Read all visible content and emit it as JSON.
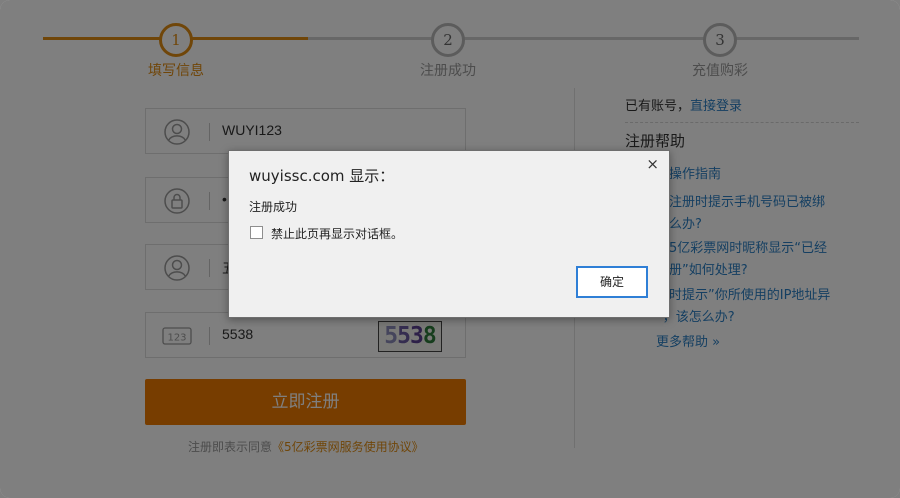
{
  "steps": [
    {
      "number": "1",
      "label": "填写信息"
    },
    {
      "number": "2",
      "label": "注册成功"
    },
    {
      "number": "3",
      "label": "充值购彩"
    }
  ],
  "form": {
    "username_value": "WUYI123",
    "password_value": "•",
    "nickname_value": "五",
    "captcha_input_value": "5538",
    "captcha_image_chars": [
      "5",
      "5",
      "3",
      "8"
    ],
    "captcha_char_colors": [
      "#8a8ab8",
      "#6a5aa0",
      "#5a4090",
      "#2d7a3a"
    ],
    "submit_label": "立即注册",
    "agreement_prefix": "注册即表示同意",
    "agreement_link": "《5亿彩票网服务使用协议》"
  },
  "help": {
    "have_account_prefix": "已有账号，",
    "login_link": "直接登录",
    "title": "注册帮助",
    "items": [
      "手操作指南",
      "机注册时提示手机号码已被绑\n怎么办?",
      "册5亿彩票网时昵称显示“已经\n注册”如何处理?",
      "册时提示”你所使用的IP地址异\n”，该怎么办?"
    ],
    "more": "更多帮助 »"
  },
  "dialog": {
    "title": "wuyissc.com 显示：",
    "close": "×",
    "message": "注册成功",
    "checkbox_label": "禁止此页再显示对话框。",
    "ok_label": "确定"
  },
  "colors": {
    "accent": "#e08c12",
    "button": "#ee7b00",
    "link": "#2a7fc4"
  }
}
